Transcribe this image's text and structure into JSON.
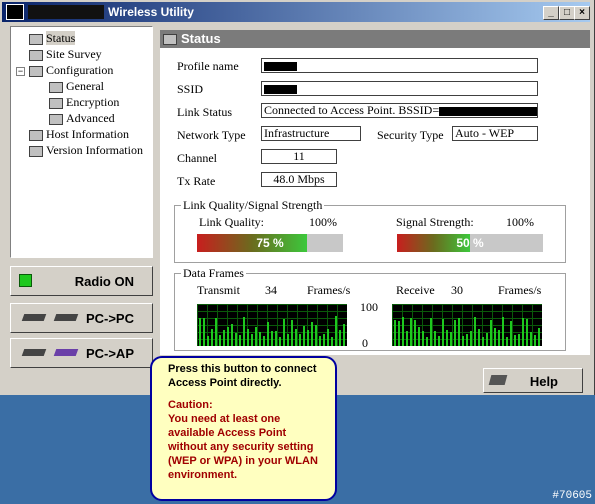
{
  "window": {
    "title": "Wireless Utility",
    "controls": [
      "_",
      "□",
      "×"
    ]
  },
  "tree": {
    "items": [
      {
        "label": "Status"
      },
      {
        "label": "Site Survey"
      },
      {
        "label": "Configuration"
      },
      {
        "label": "General"
      },
      {
        "label": "Encryption"
      },
      {
        "label": "Advanced"
      },
      {
        "label": "Host Information"
      },
      {
        "label": "Version Information"
      }
    ]
  },
  "buttons": {
    "radio": "Radio ON",
    "pc_pc": "PC->PC",
    "pc_ap": "PC->AP",
    "help": "Help"
  },
  "status": {
    "header": "Status",
    "profile_name_label": "Profile name",
    "ssid_label": "SSID",
    "link_status_label": "Link Status",
    "link_status_value": "Connected to Access Point. BSSID=",
    "network_type_label": "Network Type",
    "network_type_value": "Infrastructure",
    "security_type_label": "Security Type",
    "security_type_value": "Auto - WEP",
    "channel_label": "Channel",
    "channel_value": "11",
    "tx_rate_label": "Tx Rate",
    "tx_rate_value": "48.0 Mbps"
  },
  "signal": {
    "group_title": "Link Quality/Signal Strength",
    "link_quality_label": "Link Quality:",
    "link_quality_max": "100%",
    "link_quality_text": "75 %",
    "link_quality_value": 0.75,
    "signal_strength_label": "Signal Strength:",
    "signal_strength_max": "100%",
    "signal_strength_text": "50 %",
    "signal_strength_value": 0.5
  },
  "frames": {
    "group_title": "Data Frames",
    "transmit_label": "Transmit",
    "transmit_value": "34",
    "transmit_unit": "Frames/s",
    "receive_label": "Receive",
    "receive_value": "30",
    "receive_unit": "Frames/s",
    "scale_max": "100",
    "scale_min": "0"
  },
  "tooltip": {
    "main": "Press this button to connect Access Point directly.",
    "caution_title": "Caution:",
    "caution_text": "You need at least one available Access Point without any security setting (WEP or WPA) in your WLAN environment."
  },
  "watermark": "#70605",
  "colors": {
    "desktop": "#3a6ea5",
    "titlebar_start": "#0a246a",
    "panel_header": "#7b7b7b",
    "graph_bar": "#1ec81e",
    "tooltip_bg": "#ffffc0",
    "tooltip_border": "#0000a0",
    "caution_text": "#a00000"
  }
}
